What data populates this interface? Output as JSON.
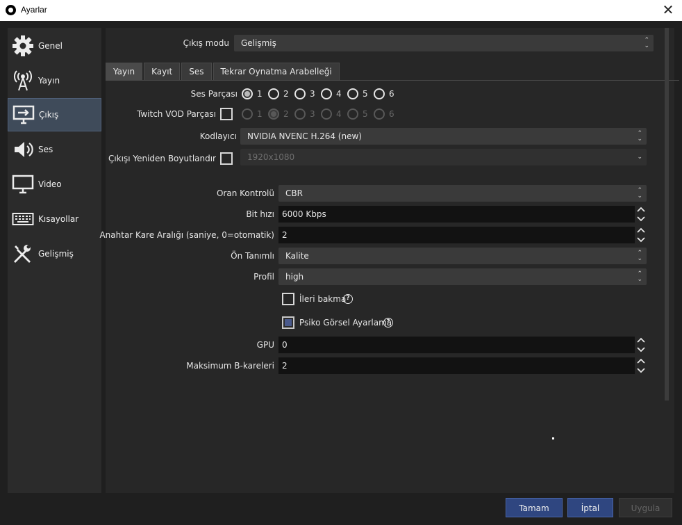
{
  "window": {
    "title": "Ayarlar",
    "close_glyph": "✕"
  },
  "sidebar": {
    "items": [
      {
        "label": "Genel",
        "icon": "gear-icon"
      },
      {
        "label": "Yayın",
        "icon": "broadcast-icon"
      },
      {
        "label": "Çıkış",
        "icon": "output-icon"
      },
      {
        "label": "Ses",
        "icon": "speaker-icon"
      },
      {
        "label": "Video",
        "icon": "monitor-icon"
      },
      {
        "label": "Kısayollar",
        "icon": "keyboard-icon"
      },
      {
        "label": "Gelişmiş",
        "icon": "tools-icon"
      }
    ],
    "active_index": 2
  },
  "output": {
    "mode_label": "Çıkış modu",
    "mode_value": "Gelişmiş",
    "tabs": [
      "Yayın",
      "Kayıt",
      "Ses",
      "Tekrar Oynatma Arabelleği"
    ],
    "active_tab": 0,
    "audio_track_label": "Ses Parçası",
    "audio_tracks": [
      "1",
      "2",
      "3",
      "4",
      "5",
      "6"
    ],
    "audio_track_selected": "1",
    "twitch_vod_label": "Twitch VOD Parçası",
    "twitch_vod_checked": false,
    "twitch_tracks": [
      "1",
      "2",
      "3",
      "4",
      "5",
      "6"
    ],
    "twitch_track_selected": "2",
    "encoder_label": "Kodlayıcı",
    "encoder_value": "NVIDIA NVENC H.264 (new)",
    "rescale_label": "Çıkışı Yeniden Boyutlandır",
    "rescale_checked": false,
    "rescale_value": "1920x1080",
    "rate_control_label": "Oran Kontrolü",
    "rate_control_value": "CBR",
    "bitrate_label": "Bit hızı",
    "bitrate_value": "6000 Kbps",
    "keyframe_label": "Anahtar Kare Aralığı (saniye, 0=otomatik)",
    "keyframe_value": "2",
    "preset_label": "Ön Tanımlı",
    "preset_value": "Kalite",
    "profile_label": "Profil",
    "profile_value": "high",
    "lookahead_label": "İleri bakma",
    "lookahead_checked": false,
    "psycho_label": "Psiko Görsel Ayarlama",
    "psycho_checked": true,
    "gpu_label": "GPU",
    "gpu_value": "0",
    "max_bframes_label": "Maksimum B-kareleri",
    "max_bframes_value": "2",
    "help_glyph": "?"
  },
  "buttons": {
    "ok": "Tamam",
    "cancel": "İptal",
    "apply": "Uygula"
  },
  "colors": {
    "accent": "#2f4680",
    "active_nav": "#3f4b5a"
  }
}
